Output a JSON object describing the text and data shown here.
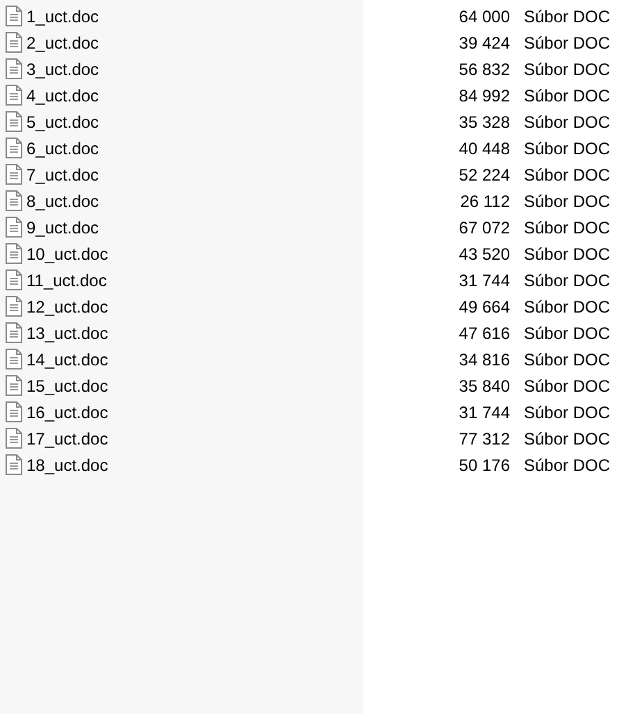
{
  "files": [
    {
      "name": "1_uct.doc",
      "size": "64 000",
      "type": "Súbor DOC"
    },
    {
      "name": "2_uct.doc",
      "size": "39 424",
      "type": "Súbor DOC"
    },
    {
      "name": "3_uct.doc",
      "size": "56 832",
      "type": "Súbor DOC"
    },
    {
      "name": "4_uct.doc",
      "size": "84 992",
      "type": "Súbor DOC"
    },
    {
      "name": "5_uct.doc",
      "size": "35 328",
      "type": "Súbor DOC"
    },
    {
      "name": "6_uct.doc",
      "size": "40 448",
      "type": "Súbor DOC"
    },
    {
      "name": "7_uct.doc",
      "size": "52 224",
      "type": "Súbor DOC"
    },
    {
      "name": "8_uct.doc",
      "size": "26 112",
      "type": "Súbor DOC"
    },
    {
      "name": "9_uct.doc",
      "size": "67 072",
      "type": "Súbor DOC"
    },
    {
      "name": "10_uct.doc",
      "size": "43 520",
      "type": "Súbor DOC"
    },
    {
      "name": "11_uct.doc",
      "size": "31 744",
      "type": "Súbor DOC"
    },
    {
      "name": "12_uct.doc",
      "size": "49 664",
      "type": "Súbor DOC"
    },
    {
      "name": "13_uct.doc",
      "size": "47 616",
      "type": "Súbor DOC"
    },
    {
      "name": "14_uct.doc",
      "size": "34 816",
      "type": "Súbor DOC"
    },
    {
      "name": "15_uct.doc",
      "size": "35 840",
      "type": "Súbor DOC"
    },
    {
      "name": "16_uct.doc",
      "size": "31 744",
      "type": "Súbor DOC"
    },
    {
      "name": "17_uct.doc",
      "size": "77 312",
      "type": "Súbor DOC"
    },
    {
      "name": "18_uct.doc",
      "size": "50 176",
      "type": "Súbor DOC"
    }
  ]
}
